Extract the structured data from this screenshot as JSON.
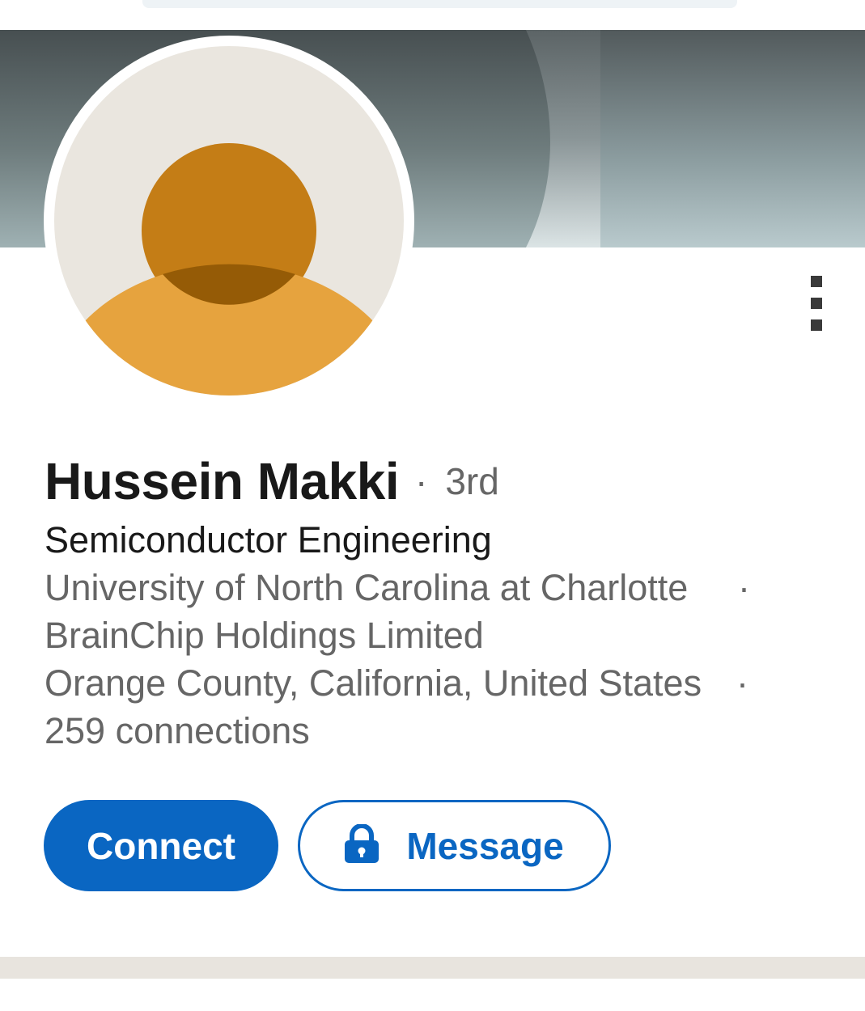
{
  "profile": {
    "name": "Hussein Makki",
    "degree_separator": "·",
    "degree": "3rd",
    "headline": "Semiconductor Engineering",
    "education_and_company_line1": "University of North Carolina at Charlotte",
    "education_and_company_line2": "BrainChip Holdings Limited",
    "location": "Orange County, California, United States",
    "connections": "259 connections",
    "inline_separator": "·"
  },
  "actions": {
    "connect_label": "Connect",
    "message_label": "Message",
    "message_icon": "lock-icon",
    "more_icon": "more-vertical-icon"
  },
  "colors": {
    "brand_blue": "#0a66c2",
    "avatar_head": "#c47d16",
    "avatar_body": "#e6a33e",
    "avatar_background": "#eae6df"
  }
}
